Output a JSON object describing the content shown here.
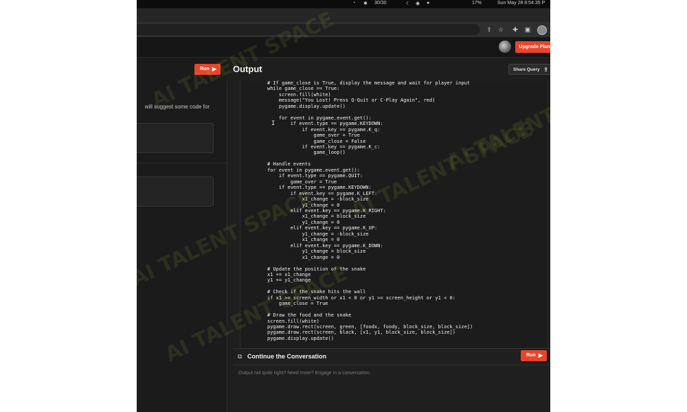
{
  "menubar": {
    "battery": "17%",
    "status": "30/30",
    "datetime": "Sun May 28 8:54:35 P"
  },
  "app": {
    "upgrade_label": "Upgrade Plan"
  },
  "left_panel": {
    "run_label": "Run",
    "hint_text": "will suggest some code for"
  },
  "output": {
    "title": "Output",
    "share_label": "Share Query",
    "run_label": "Run",
    "code": "# If game_close is True, display the message and wait for player input\nwhile game_close == True:\n    screen.fill(white)\n    message(\"You Lost! Press Q-Quit or C-Play Again\", red)\n    pygame.display.update()\n\n    for event in pygame.event.get():\n        if event.type == pygame.KEYDOWN:\n            if event.key == pygame.K_q:\n                game_over = True\n                game_close = False\n            if event.key == pygame.K_c:\n                game_loop()\n\n# Handle events\nfor event in pygame.event.get():\n    if event.type == pygame.QUIT:\n        game_over = True\n    if event.type == pygame.KEYDOWN:\n        if event.key == pygame.K_LEFT:\n            x1_change = -block_size\n            y1_change = 0\n        elif event.key == pygame.K_RIGHT:\n            x1_change = block_size\n            y1_change = 0\n        elif event.key == pygame.K_UP:\n            y1_change = -block_size\n            x1_change = 0\n        elif event.key == pygame.K_DOWN:\n            y1_change = block_size\n            x1_change = 0\n\n# Update the position of the snake\nx1 += x1_change\ny1 += y1_change\n\n# Check if the snake hits the wall\nif x1 >= screen_width or x1 < 0 or y1 >= screen_height or y1 < 0:\n    game_close = True\n\n# Draw the food and the snake\nscreen.fill(white)\npygame.draw.rect(screen, green, [foodx, foody, block_size, block_size])\npygame.draw.rect(screen, black, [x1, y1, block_size, block_size])\npygame.display.update()"
  },
  "conversation": {
    "title": "Continue the Conversation",
    "placeholder": "Output not quite right? Need more? Engage in a conversation.",
    "run_label": "Run"
  },
  "watermark": "AI TALENT SPACE",
  "colors": {
    "accent": "#e8452c",
    "background": "#1e1e1e"
  }
}
